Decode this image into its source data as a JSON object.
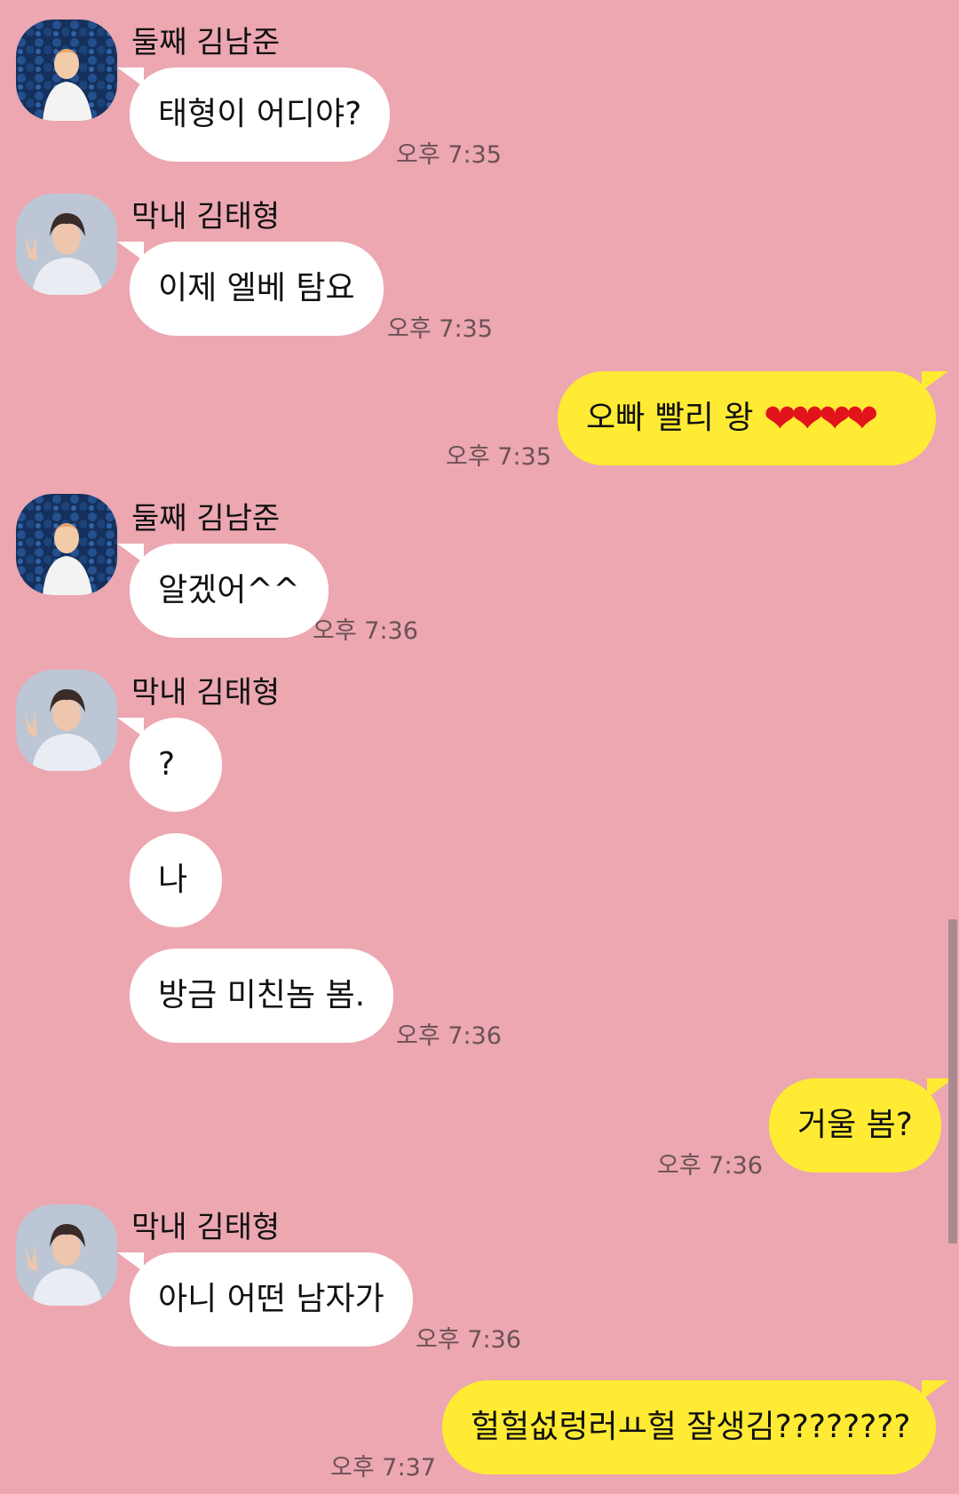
{
  "senders": {
    "namjoon": "둘째 김남준",
    "taehyung": "막내 김태형"
  },
  "messages": [
    {
      "text": "태형이 어디야?",
      "time": "오후 7:35"
    },
    {
      "text": "이제 엘베 탐요",
      "time": "오후 7:35"
    },
    {
      "text": "오빠 빨리 왕",
      "hearts": "❤❤❤❤",
      "time": "오후 7:35"
    },
    {
      "text": "알겠어^^",
      "time": "오후 7:36"
    },
    {
      "text": "?"
    },
    {
      "text": "나"
    },
    {
      "text": "방금 미친놈 봄.",
      "time": "오후 7:36"
    },
    {
      "text": "거울 봄?",
      "time": "오후 7:36"
    },
    {
      "text": "아니 어떤 남자가",
      "time": "오후 7:36"
    },
    {
      "text": "헐헐섮렁러ㅛ헐 잘생김????????",
      "time": "오후 7:37"
    }
  ],
  "colors": {
    "background": "#eca7b1",
    "incoming_bubble": "#ffffff",
    "outgoing_bubble": "#ffeb33"
  }
}
